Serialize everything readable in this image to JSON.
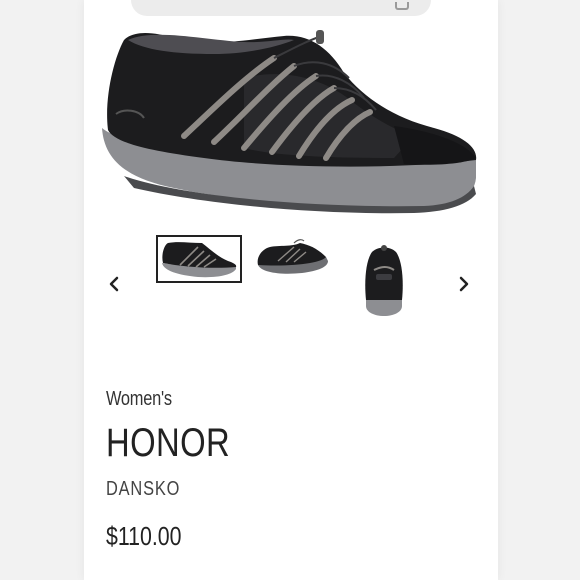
{
  "product": {
    "eyebrow": "Women's",
    "name": "HONOR",
    "brand": "DANSKO",
    "price": "$110.00"
  },
  "gallery": {
    "hero_image": "black-suede-mesh-sneaker-side-view",
    "thumbnails": [
      {
        "image": "shoe-side-view",
        "selected": true
      },
      {
        "image": "shoe-angled-view",
        "selected": false
      },
      {
        "image": "shoe-heel-view",
        "selected": false
      }
    ],
    "prev_icon": "chevron-left-icon",
    "next_icon": "chevron-right-icon"
  },
  "colors": {
    "shoe_upper": "#1c1c1e",
    "shoe_sole": "#8d8e92",
    "laces": "#8e8a86",
    "text": "#222222"
  }
}
